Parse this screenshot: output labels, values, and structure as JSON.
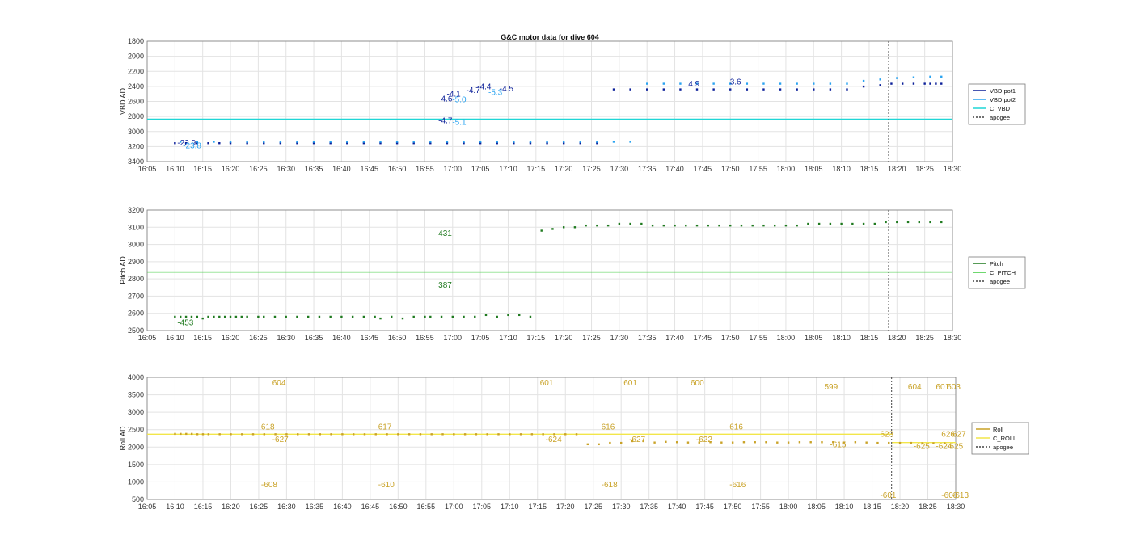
{
  "title": "G&C motor data for dive 604",
  "colors": {
    "vbd_pot1": "#0b1f99",
    "vbd_pot2": "#2aa3f0",
    "c_vbd": "#1fd6d6",
    "pitch": "#1f7a1f",
    "c_pitch": "#3fcc3f",
    "roll": "#c9a227",
    "c_roll": "#f2e64a",
    "apogee": "#444444"
  },
  "chart_data": [
    {
      "type": "scatter",
      "ylabel": "VBD AD",
      "ylim": [
        1800,
        3500
      ],
      "y_reversed": true,
      "yticks": [
        "1800",
        "2000",
        "2200",
        "2400",
        "2600",
        "2800",
        "3000",
        "3200",
        "3400"
      ],
      "xlim": [
        965,
        1110
      ],
      "xticks": [
        "16:05",
        "16:10",
        "16:15",
        "16:20",
        "16:25",
        "16:30",
        "16:35",
        "16:40",
        "16:45",
        "16:50",
        "16:55",
        "17:00",
        "17:05",
        "17:10",
        "17:15",
        "17:20",
        "17:25",
        "17:30",
        "17:35",
        "17:40",
        "17:45",
        "17:50",
        "17:55",
        "18:00",
        "18:05",
        "18:10",
        "18:15",
        "18:20",
        "18:25",
        "18:30"
      ],
      "grid": true,
      "legend_position": "outside-right",
      "legend": [
        "VBD pot1",
        "VBD pot2",
        "C_VBD",
        "apogee"
      ],
      "reference_value": 2900,
      "apogee_x": 1098.5,
      "series": [
        {
          "name": "VBD pot1",
          "x": [
            970,
            972,
            974,
            976,
            978,
            980,
            983,
            986,
            989,
            992,
            995,
            998,
            1001,
            1004,
            1007,
            1010,
            1013,
            1016,
            1019,
            1022,
            1025,
            1028,
            1031,
            1034,
            1037,
            1040,
            1043,
            1046,
            1049,
            1052,
            1055,
            1058,
            1061,
            1064,
            1067,
            1070,
            1073,
            1076,
            1079,
            1082,
            1085,
            1088,
            1091,
            1094,
            1097,
            1099,
            1101,
            1103,
            1105,
            1106,
            1107,
            1108
          ],
          "y": [
            3240,
            3240,
            3240,
            3240,
            3240,
            3240,
            3240,
            3240,
            3240,
            3240,
            3240,
            3240,
            3240,
            3240,
            3240,
            3240,
            3240,
            3240,
            3240,
            3240,
            3240,
            3240,
            3240,
            3240,
            3240,
            3240,
            3240,
            3240,
            2480,
            2480,
            2480,
            2480,
            2480,
            2480,
            2480,
            2480,
            2480,
            2480,
            2480,
            2480,
            2480,
            2480,
            2480,
            2440,
            2420,
            2400,
            2400,
            2400,
            2400,
            2400,
            2400,
            2400
          ]
        },
        {
          "name": "VBD pot2",
          "x": [
            971,
            974,
            977,
            980,
            983,
            986,
            989,
            992,
            995,
            998,
            1001,
            1004,
            1007,
            1010,
            1013,
            1016,
            1019,
            1022,
            1025,
            1028,
            1031,
            1034,
            1037,
            1040,
            1043,
            1046,
            1049,
            1052,
            1055,
            1058,
            1061,
            1064,
            1067,
            1070,
            1073,
            1076,
            1079,
            1082,
            1085,
            1088,
            1091,
            1094,
            1097,
            1100,
            1103,
            1106,
            1108
          ],
          "y": [
            3220,
            3220,
            3220,
            3220,
            3220,
            3220,
            3220,
            3220,
            3220,
            3220,
            3220,
            3220,
            3220,
            3220,
            3220,
            3220,
            3220,
            3220,
            3220,
            3220,
            3220,
            3220,
            3220,
            3220,
            3220,
            3220,
            3220,
            3220,
            2400,
            2400,
            2400,
            2400,
            2400,
            2400,
            2400,
            2400,
            2400,
            2400,
            2400,
            2400,
            2400,
            2360,
            2340,
            2320,
            2310,
            2300,
            2300
          ]
        },
        {
          "name": "C_VBD",
          "value": 2900
        }
      ],
      "annotations": [
        {
          "text": "-22.9",
          "x": 970,
          "y": 3270
        },
        {
          "text": "-23.8",
          "x": 971,
          "y": 3310
        },
        {
          "text": "-4.6",
          "x": 1017,
          "y": 2650
        },
        {
          "text": "-4.7",
          "x": 1017,
          "y": 2960
        },
        {
          "text": "-4.1",
          "x": 1018.5,
          "y": 2580
        },
        {
          "text": "-5.0",
          "x": 1019.5,
          "y": 2660
        },
        {
          "text": "-5.1",
          "x": 1019.5,
          "y": 2980
        },
        {
          "text": "-4.7",
          "x": 1022,
          "y": 2530
        },
        {
          "text": "-4.4",
          "x": 1024,
          "y": 2480
        },
        {
          "text": "-5.3",
          "x": 1026,
          "y": 2560
        },
        {
          "text": "-4.5",
          "x": 1028,
          "y": 2510
        },
        {
          "text": "4.9",
          "x": 1062,
          "y": 2440
        },
        {
          "text": "-3.6",
          "x": 1069,
          "y": 2410
        }
      ]
    },
    {
      "type": "scatter",
      "ylabel": "Pitch AD",
      "ylim": [
        2500,
        3200
      ],
      "yticks": [
        "2500",
        "2600",
        "2700",
        "2800",
        "2900",
        "3000",
        "3100",
        "3200"
      ],
      "xlim": [
        965,
        1110
      ],
      "xticks": [
        "16:05",
        "16:10",
        "16:15",
        "16:20",
        "16:25",
        "16:30",
        "16:35",
        "16:40",
        "16:45",
        "16:50",
        "16:55",
        "17:00",
        "17:05",
        "17:10",
        "17:15",
        "17:20",
        "17:25",
        "17:30",
        "17:35",
        "17:40",
        "17:45",
        "17:50",
        "17:55",
        "18:00",
        "18:05",
        "18:10",
        "18:15",
        "18:20",
        "18:25",
        "18:30"
      ],
      "grid": true,
      "legend_position": "outside-right",
      "legend": [
        "Pitch",
        "C_PITCH",
        "apogee"
      ],
      "reference_value": 2840,
      "apogee_x": 1098.5,
      "series": [
        {
          "name": "Pitch",
          "x": [
            970,
            971,
            972,
            973,
            974,
            975,
            976,
            977,
            978,
            979,
            980,
            981,
            982,
            983,
            985,
            986,
            988,
            990,
            992,
            994,
            996,
            998,
            1000,
            1002,
            1004,
            1006,
            1007,
            1009,
            1011,
            1013,
            1015,
            1016,
            1018,
            1020,
            1022,
            1024,
            1026,
            1028,
            1030,
            1032,
            1034,
            1036,
            1038,
            1040,
            1042,
            1044,
            1046,
            1048,
            1050,
            1052,
            1054,
            1056,
            1058,
            1060,
            1062,
            1064,
            1066,
            1068,
            1070,
            1072,
            1074,
            1076,
            1078,
            1080,
            1082,
            1084,
            1086,
            1088,
            1090,
            1092,
            1094,
            1096,
            1098,
            1100,
            1102,
            1104,
            1106,
            1108
          ],
          "y": [
            2580,
            2580,
            2580,
            2580,
            2580,
            2570,
            2580,
            2580,
            2580,
            2580,
            2580,
            2580,
            2580,
            2580,
            2580,
            2580,
            2580,
            2580,
            2580,
            2580,
            2580,
            2580,
            2580,
            2580,
            2580,
            2580,
            2570,
            2580,
            2570,
            2580,
            2580,
            2580,
            2580,
            2580,
            2580,
            2580,
            2590,
            2580,
            2590,
            2590,
            2580,
            3080,
            3090,
            3100,
            3100,
            3110,
            3110,
            3110,
            3120,
            3120,
            3120,
            3110,
            3110,
            3110,
            3110,
            3110,
            3110,
            3110,
            3110,
            3110,
            3110,
            3110,
            3110,
            3110,
            3110,
            3120,
            3120,
            3120,
            3120,
            3120,
            3120,
            3120,
            3130,
            3130,
            3130,
            3130,
            3130,
            3130
          ]
        },
        {
          "name": "C_PITCH",
          "value": 2840
        }
      ],
      "annotations": [
        {
          "text": "-453",
          "x": 970,
          "y": 2530
        },
        {
          "text": "431",
          "x": 1017,
          "y": 3050
        },
        {
          "text": "387",
          "x": 1017,
          "y": 2750
        }
      ]
    },
    {
      "type": "scatter",
      "ylabel": "Roll AD",
      "ylim": [
        500,
        4000
      ],
      "yticks": [
        "500",
        "1000",
        "1500",
        "2000",
        "2500",
        "3000",
        "3500",
        "4000"
      ],
      "xlim": [
        965,
        1110
      ],
      "xticks": [
        "16:05",
        "16:10",
        "16:15",
        "16:20",
        "16:25",
        "16:30",
        "16:35",
        "16:40",
        "16:45",
        "16:50",
        "16:55",
        "17:00",
        "17:05",
        "17:10",
        "17:15",
        "17:20",
        "17:25",
        "17:30",
        "17:35",
        "17:40",
        "17:45",
        "17:50",
        "17:55",
        "18:00",
        "18:05",
        "18:10",
        "18:15",
        "18:20",
        "18:25",
        "18:30"
      ],
      "grid": true,
      "legend_position": "outside-right",
      "legend": [
        "Roll",
        "C_ROLL",
        "apogee"
      ],
      "reference_values": [
        2370,
        2130
      ],
      "apogee_x": 1098.5,
      "series": [
        {
          "name": "Roll",
          "x": [
            970,
            971,
            972,
            973,
            974,
            975,
            976,
            978,
            980,
            982,
            984,
            986,
            988,
            990,
            992,
            994,
            996,
            998,
            1000,
            1002,
            1004,
            1006,
            1008,
            1010,
            1012,
            1014,
            1016,
            1018,
            1020,
            1022,
            1024,
            1026,
            1028,
            1030,
            1032,
            1034,
            1036,
            1038,
            1040,
            1042,
            1044,
            1046,
            1048,
            1050,
            1052,
            1054,
            1056,
            1058,
            1060,
            1062,
            1064,
            1066,
            1068,
            1070,
            1072,
            1074,
            1076,
            1078,
            1080,
            1082,
            1084,
            1086,
            1088,
            1090,
            1092,
            1094,
            1096,
            1098,
            1100,
            1102,
            1104,
            1106,
            1108
          ],
          "y": [
            2380,
            2380,
            2380,
            2380,
            2370,
            2370,
            2370,
            2370,
            2370,
            2370,
            2370,
            2370,
            2370,
            2370,
            2370,
            2370,
            2370,
            2370,
            2370,
            2370,
            2370,
            2370,
            2370,
            2370,
            2370,
            2370,
            2370,
            2370,
            2370,
            2370,
            2370,
            2370,
            2370,
            2370,
            2370,
            2370,
            2370,
            2370,
            2370,
            2370,
            2080,
            2080,
            2120,
            2120,
            2170,
            2170,
            2130,
            2150,
            2140,
            2130,
            2130,
            2140,
            2130,
            2130,
            2140,
            2140,
            2140,
            2130,
            2130,
            2140,
            2140,
            2140,
            2140,
            2130,
            2140,
            2130,
            2120,
            2120,
            2120,
            2120,
            2110,
            2110,
            2110
          ]
        },
        {
          "name": "C_ROLL",
          "values": [
            2370,
            2130
          ]
        }
      ],
      "annotations": [
        {
          "text": "604",
          "x": 987,
          "y": 3850
        },
        {
          "text": "618",
          "x": 985,
          "y": 2500
        },
        {
          "text": "-608",
          "x": 985,
          "y": 850
        },
        {
          "text": "-627",
          "x": 987,
          "y": 2150
        },
        {
          "text": "617",
          "x": 1006,
          "y": 2500
        },
        {
          "text": "-610",
          "x": 1006,
          "y": 850
        },
        {
          "text": "601",
          "x": 1035,
          "y": 3850
        },
        {
          "text": "-624",
          "x": 1036,
          "y": 2150
        },
        {
          "text": "616",
          "x": 1046,
          "y": 2500
        },
        {
          "text": "-618",
          "x": 1046,
          "y": 850
        },
        {
          "text": "601",
          "x": 1050,
          "y": 3850
        },
        {
          "text": "-627",
          "x": 1051,
          "y": 2150
        },
        {
          "text": "600",
          "x": 1062,
          "y": 3850
        },
        {
          "text": "-622",
          "x": 1063,
          "y": 2150
        },
        {
          "text": "616",
          "x": 1069,
          "y": 2500
        },
        {
          "text": "-616",
          "x": 1069,
          "y": 850
        },
        {
          "text": "599",
          "x": 1086,
          "y": 3650
        },
        {
          "text": "-615",
          "x": 1087,
          "y": 2000
        },
        {
          "text": "623",
          "x": 1096,
          "y": 2300
        },
        {
          "text": "-601",
          "x": 1096,
          "y": 550
        },
        {
          "text": "604",
          "x": 1101,
          "y": 3650
        },
        {
          "text": "-625",
          "x": 1102,
          "y": 1950
        },
        {
          "text": "601",
          "x": 1106,
          "y": 3650
        },
        {
          "text": "-624",
          "x": 1106,
          "y": 1950
        },
        {
          "text": "626",
          "x": 1107,
          "y": 2300
        },
        {
          "text": "-608",
          "x": 1107,
          "y": 550
        },
        {
          "text": "603",
          "x": 1108,
          "y": 3650
        },
        {
          "text": "-625",
          "x": 1108,
          "y": 1950
        },
        {
          "text": "627",
          "x": 1109,
          "y": 2300
        },
        {
          "text": "-613",
          "x": 1109,
          "y": 550
        }
      ]
    }
  ]
}
